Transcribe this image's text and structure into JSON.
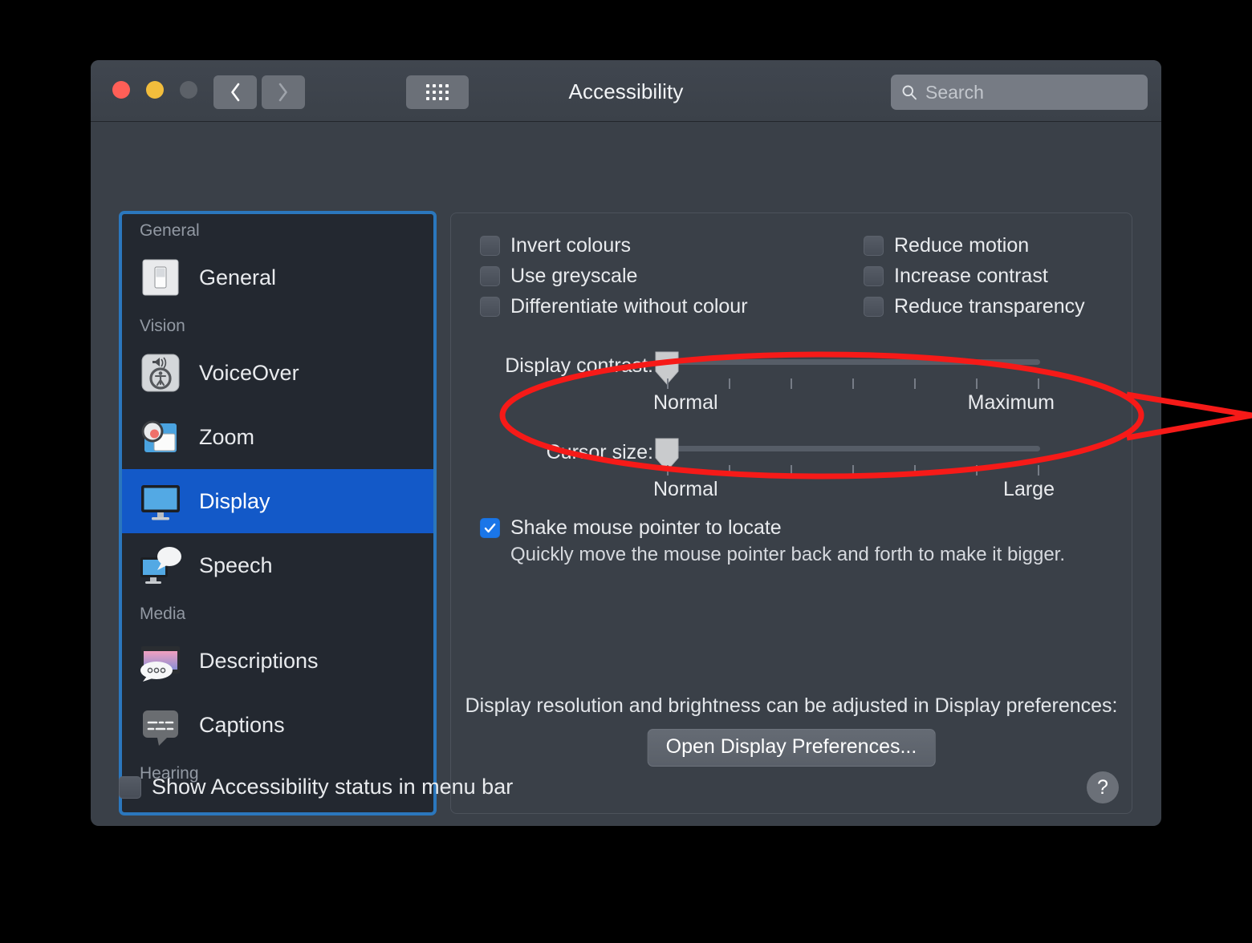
{
  "window": {
    "title": "Accessibility",
    "traffic_lights": [
      "close-red",
      "minimise-yellow",
      "zoom-grey-disabled"
    ],
    "nav": {
      "back_icon": "chevron-left-icon",
      "forward_icon": "chevron-right-icon",
      "show_all_icon": "grid-dots-icon"
    },
    "search": {
      "placeholder": "Search",
      "value": "",
      "icon": "search-icon"
    }
  },
  "sidebar": {
    "groups": [
      {
        "header": "General",
        "items": [
          {
            "label": "General",
            "icon": "switch-toggle-icon",
            "selected": false
          }
        ]
      },
      {
        "header": "Vision",
        "items": [
          {
            "label": "VoiceOver",
            "icon": "voiceover-icon",
            "selected": false
          },
          {
            "label": "Zoom",
            "icon": "zoom-magnifier-icon",
            "selected": false
          },
          {
            "label": "Display",
            "icon": "display-monitor-icon",
            "selected": true
          },
          {
            "label": "Speech",
            "icon": "speech-bubble-monitor-icon",
            "selected": false
          }
        ]
      },
      {
        "header": "Media",
        "items": [
          {
            "label": "Descriptions",
            "icon": "descriptions-icon",
            "selected": false
          },
          {
            "label": "Captions",
            "icon": "captions-icon",
            "selected": false
          }
        ]
      },
      {
        "header": "Hearing",
        "items": []
      }
    ]
  },
  "main": {
    "checkboxes_left": [
      {
        "label": "Invert colours",
        "checked": false
      },
      {
        "label": "Use greyscale",
        "checked": false
      },
      {
        "label": "Differentiate without colour",
        "checked": false
      }
    ],
    "checkboxes_right": [
      {
        "label": "Reduce motion",
        "checked": false
      },
      {
        "label": "Increase contrast",
        "checked": false
      },
      {
        "label": "Reduce transparency",
        "checked": false
      }
    ],
    "sliders": [
      {
        "label": "Display contrast:",
        "min_label": "Normal",
        "max_label": "Maximum",
        "value_percent": 0,
        "ticks": 7
      },
      {
        "label": "Cursor size:",
        "min_label": "Normal",
        "max_label": "Large",
        "value_percent": 0,
        "ticks": 7
      }
    ],
    "shake": {
      "label": "Shake mouse pointer to locate",
      "checked": true,
      "description": "Quickly move the mouse pointer back and forth to make it bigger."
    },
    "bottom_note": "Display resolution and brightness can be adjusted in Display preferences:",
    "open_display_button": "Open Display Preferences..."
  },
  "footer": {
    "menubar_checkbox": {
      "label": "Show Accessibility status in menu bar",
      "checked": false
    },
    "help_button": "?"
  },
  "annotation": {
    "type": "ellipse-with-pointer",
    "colour": "#f61a18",
    "target": "Cursor size:"
  }
}
